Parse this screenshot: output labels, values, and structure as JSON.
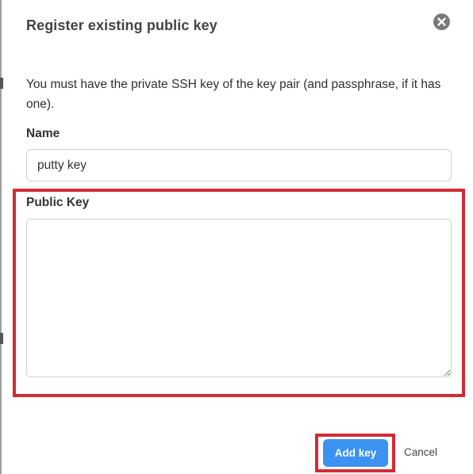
{
  "dialog": {
    "title": "Register existing public key",
    "close_icon": "close-circle-icon",
    "description": "You must have the private SSH key of the key pair (and passphrase, if it has one).",
    "name_field": {
      "label": "Name",
      "value": "putty key",
      "placeholder": ""
    },
    "public_key_field": {
      "label": "Public Key",
      "value": "",
      "placeholder": ""
    },
    "actions": {
      "add_key_label": "Add key",
      "cancel_label": "Cancel"
    }
  },
  "colors": {
    "primary_button": "#3b92f0",
    "highlight_border": "#d42a33",
    "close_icon_bg": "#7a7a7a"
  }
}
